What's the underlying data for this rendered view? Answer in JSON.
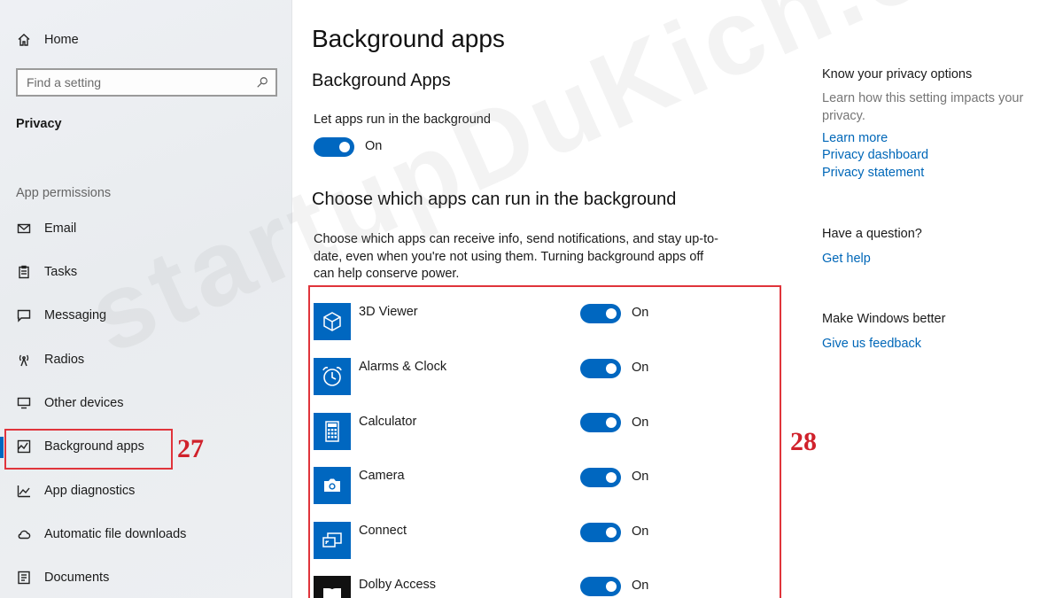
{
  "sidebar": {
    "home": "Home",
    "search_placeholder": "Find a setting",
    "section": "Privacy",
    "group": "App permissions",
    "items": [
      {
        "label": "Email",
        "icon": "mail-icon"
      },
      {
        "label": "Tasks",
        "icon": "clipboard-icon"
      },
      {
        "label": "Messaging",
        "icon": "chat-icon"
      },
      {
        "label": "Radios",
        "icon": "antenna-icon"
      },
      {
        "label": "Other devices",
        "icon": "devices-icon"
      },
      {
        "label": "Background apps",
        "icon": "activity-icon",
        "selected": true
      },
      {
        "label": "App diagnostics",
        "icon": "chart-icon"
      },
      {
        "label": "Automatic file downloads",
        "icon": "cloud-icon"
      },
      {
        "label": "Documents",
        "icon": "document-icon"
      }
    ]
  },
  "main": {
    "title": "Background apps",
    "subtitle": "Background Apps",
    "master_label": "Let apps run in the background",
    "master_state": "On",
    "choose_heading": "Choose which apps can run in the background",
    "choose_desc": "Choose which apps can receive info, send notifications, and stay up-to-date, even when you're not using them. Turning background apps off can help conserve power.",
    "apps": [
      {
        "name": "3D Viewer",
        "state": "On",
        "icon": "cube-icon"
      },
      {
        "name": "Alarms & Clock",
        "state": "On",
        "icon": "alarm-clock-icon"
      },
      {
        "name": "Calculator",
        "state": "On",
        "icon": "calculator-icon"
      },
      {
        "name": "Camera",
        "state": "On",
        "icon": "camera-icon"
      },
      {
        "name": "Connect",
        "state": "On",
        "icon": "cast-icon"
      },
      {
        "name": "Dolby Access",
        "state": "On",
        "icon": "dolby-icon"
      }
    ]
  },
  "right_panel": {
    "privacy_head": "Know your privacy options",
    "privacy_desc": "Learn how this setting impacts your privacy.",
    "links": [
      "Learn more",
      "Privacy dashboard",
      "Privacy statement"
    ],
    "question_head": "Have a question?",
    "get_help": "Get help",
    "better_head": "Make Windows better",
    "feedback": "Give us feedback"
  },
  "annotations": {
    "left": "27",
    "right": "28"
  },
  "watermark": "startupDuKich.com",
  "colors": {
    "accent": "#0067c0",
    "link": "#0067b8",
    "annotation": "#d0212b"
  }
}
